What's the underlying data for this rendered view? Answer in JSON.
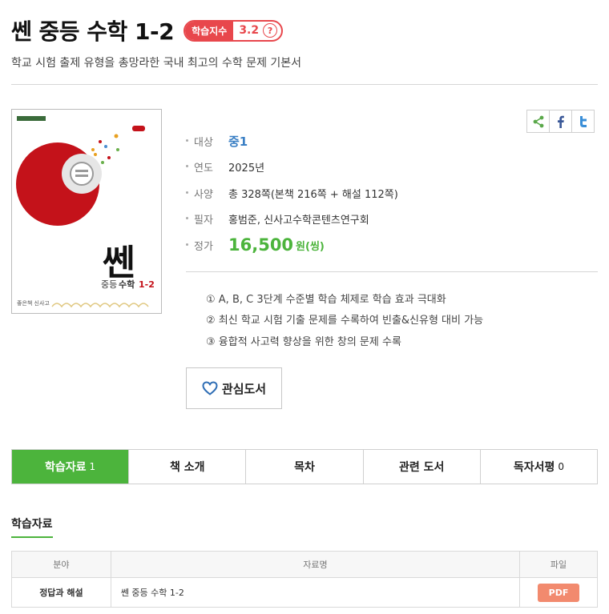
{
  "book": {
    "title": "쎈 중등 수학 1-2",
    "subtitle": "학교 시험 출제 유형을 총망라한 국내 최고의 수학 문제 기본서"
  },
  "study_index": {
    "label": "학습지수",
    "score": "3.2",
    "help": "?"
  },
  "share": {
    "icons": [
      "share-icon",
      "facebook-icon",
      "twitter-icon"
    ]
  },
  "cover": {
    "brand": "쎈",
    "series": "중등",
    "subject": "수학",
    "grade_code": "1-2",
    "publisher": "좋은책 신사고"
  },
  "info": {
    "target_label": "대상",
    "target_value": "중1",
    "year_label": "연도",
    "year_value": "2025년",
    "spec_label": "사양",
    "spec_value": "총 328쪽(본책 216쪽 + 해설 112쪽)",
    "author_label": "필자",
    "author_value": "홍범준, 신사고수학콘텐츠연구회",
    "price_label": "정가",
    "price_value": "16,500",
    "price_unit": "원(씽)"
  },
  "features": [
    "① A, B, C 3단계 수준별 학습 체제로 학습 효과 극대화",
    "② 최신 학교 시험 기출 문제를 수록하여 빈출&신유형 대비 가능",
    "③ 융합적 사고력 향상을 위한 창의 문제 수록"
  ],
  "wish_button": {
    "label": "관심도서",
    "icon": "heart-icon"
  },
  "tabs": [
    {
      "label": "학습자료",
      "count": "1"
    },
    {
      "label": "책 소개",
      "count": ""
    },
    {
      "label": "목차",
      "count": ""
    },
    {
      "label": "관련 도서",
      "count": ""
    },
    {
      "label": "독자서평",
      "count": "0"
    }
  ],
  "materials": {
    "section_title": "학습자료",
    "headers": [
      "분야",
      "자료명",
      "파일"
    ],
    "rows": [
      {
        "category": "정답과 해설",
        "name": "쎈 중등 수학 1-2",
        "file": "PDF"
      }
    ]
  },
  "colors": {
    "accent_green": "#4cb43c",
    "badge_red": "#e8474c",
    "grade_blue": "#3a7fc4",
    "pdf_orange": "#f28a6e"
  }
}
